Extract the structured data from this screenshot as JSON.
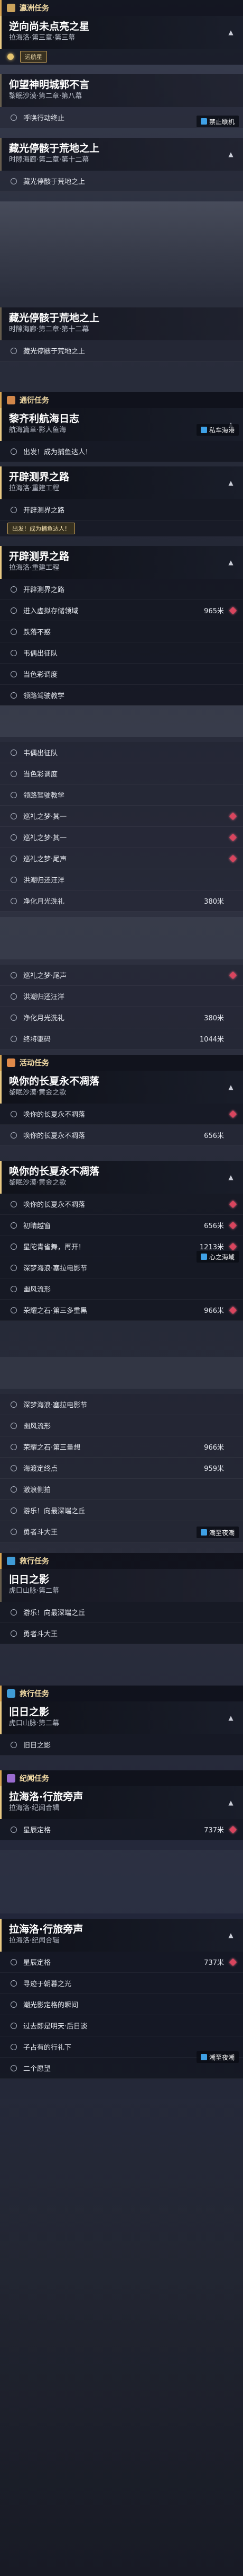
{
  "categories": {
    "cat1": "瀛洲任务",
    "cat2": "通衍任务",
    "cat3": "活动任务",
    "cat4": "救行任务",
    "cat5": "救行任务",
    "cat6": "纪闻任务"
  },
  "quests": [
    {
      "title": "逆向尚未点亮之星",
      "subtitle": "拉海洛·第三章·第三幕"
    },
    {
      "title": "仰望神明城郭不言",
      "subtitle": "黎眠沙漠·第二章·第八幕"
    },
    {
      "title": "藏光停骸于荒地之上",
      "subtitle": "时隙海廊·第二章·第十二幕"
    },
    {
      "title": "藏光停骸于荒地之上",
      "subtitle": "时隙海廊·第二章·第十二幕"
    },
    {
      "title": "黎齐利航海日志",
      "subtitle": "航海篇章·影人鱼海"
    },
    {
      "title": "开辟测界之路",
      "subtitle": "拉海洛·重建工程"
    },
    {
      "title": "开辟测界之路",
      "subtitle": "拉海洛·重建工程"
    },
    {
      "title": "唤你的长夏永不凋落",
      "subtitle": "黎眠沙漠·黄金之歌"
    },
    {
      "title": "唤你的长夏永不凋落",
      "subtitle": "黎眠沙漠·黄金之歌"
    },
    {
      "title": "旧日之影",
      "subtitle": "虎口山脉·第二幕"
    },
    {
      "title": "旧日之影",
      "subtitle": "虎口山脉·第二幕"
    },
    {
      "title": "拉海洛·行旅旁声",
      "subtitle": "拉海洛·纪闻合辑"
    },
    {
      "title": "拉海洛·行旅旁声",
      "subtitle": "拉海洛·纪闻合辑"
    }
  ],
  "badges": {
    "b1": "远航星",
    "b2": "出发！成为捕鱼达人！",
    "b3": "出发！成为捕鱼达人！"
  },
  "steps": {
    "s1": "呼唤行动终止",
    "s2": "藏光停骸于荒地之上",
    "s3": "藏光停骸于荒地之上",
    "s4": "出发！成为捕鱼达人！",
    "s5": "开辟测界之路",
    "s6": "开辟测界之路",
    "s7": "进入虚拟存储领域",
    "s7d": "965米",
    "s8": "跌落不惑",
    "s9": "韦偶出征队",
    "s10": "当色彩调度",
    "s11": "领路驾驶教学",
    "s12": "韦偶出征队",
    "s13": "当色彩调度",
    "s14": "领路驾驶教学",
    "s15": "巡礼之梦·其一",
    "s16": "巡礼之梦·其一",
    "s17": "巡礼之梦·尾声",
    "s18": "洪潮归还汪洋",
    "s19": "净化月光洗礼",
    "s19d": "380米",
    "s20": "巡礼之梦·尾声",
    "s21": "洪潮归还汪洋",
    "s22": "净化月光洗礼",
    "s22d": "380米",
    "s23": "终将驱码",
    "s23d": "1044米",
    "s24": "唤你的长夏永不凋落",
    "s25": "唤你的长夏永不凋落",
    "s25d": "656米",
    "s26": "唤你的长夏永不凋落",
    "s27": "初晴越窗",
    "s27d": "656米",
    "s28": "星陀青雀舞，再开！",
    "s28d": "1213米",
    "s29": "深梦海浪·塞拉电影节",
    "s30": "幽风流形",
    "s31": "荣耀之石·第三多重黑",
    "s31d": "966米",
    "s32": "深梦海浪·塞拉电影节",
    "s33": "幽风流形",
    "s34": "荣耀之石·第三量想",
    "s34d": "966米",
    "s35": "海渡定终点",
    "s35d": "959米",
    "s36": "激浪侧拍",
    "s37": "游乐！向最深端之丘",
    "s38": "勇者斗大王",
    "s39": "游乐！向最深端之丘",
    "s40": "勇者斗大王",
    "s41": "旧日之影",
    "s42": "星辰定格",
    "s42d": "737米",
    "s43": "星辰定格",
    "s43d": "737米",
    "s44": "寻迹于朝暮之光",
    "s45": "潮光影定格的瞬间",
    "s46": "过去即是明天·后日谈",
    "s47": "子占有的行礼下",
    "s48": "二个愿望"
  },
  "watermarks": {
    "w1": "禁止联机",
    "w2": "私车海港",
    "w3": "心之海域",
    "w4": "潮至夜潮",
    "w5": "潮至夜潮",
    "w6": "潮汐场域",
    "w7": "潮汐场域"
  },
  "colors": {
    "accent_gold": "#e6c46f",
    "marker_red": "#d9455e",
    "panel_dark": "#0e1018"
  }
}
